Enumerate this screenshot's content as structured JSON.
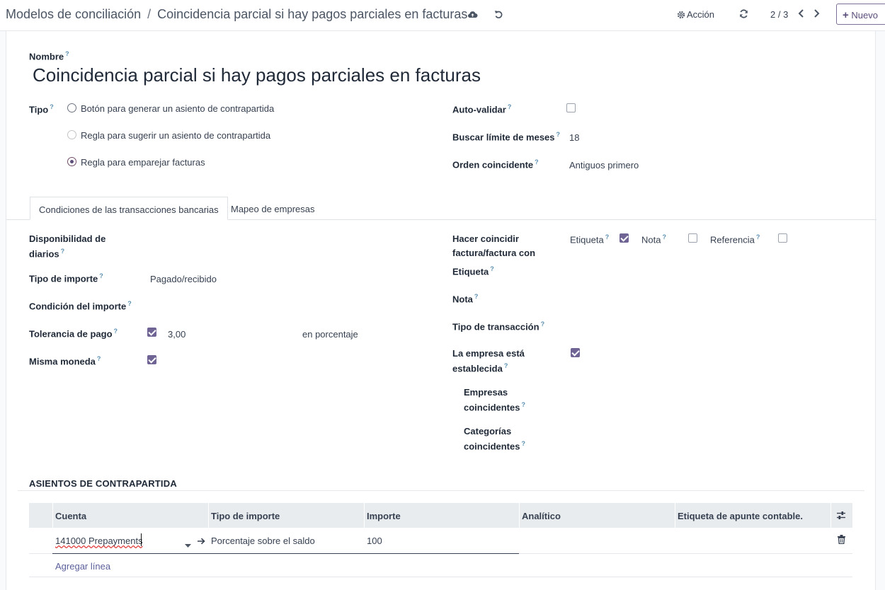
{
  "breadcrumb": {
    "parent": "Modelos de conciliación",
    "separator": "/",
    "current": "Coincidencia parcial si hay pagos parciales en facturas"
  },
  "toolbar": {
    "action_label": "Acción",
    "pager": "2 / 3",
    "new_label": "Nuevo"
  },
  "form": {
    "name_label": "Nombre",
    "name_value": "Coincidencia parcial si hay pagos parciales en facturas",
    "type_label": "Tipo",
    "type_options": [
      "Botón para generar un asiento de contrapartida",
      "Regla para sugerir un asiento de contrapartida",
      "Regla para emparejar facturas"
    ],
    "type_selected": "Regla para emparejar facturas",
    "auto_validate_label": "Auto-validar",
    "auto_validate": false,
    "month_limit_label": "Buscar límite de meses",
    "month_limit_value": "18",
    "match_order_label": "Orden coincidente",
    "match_order_value": "Antiguos primero"
  },
  "tabs": [
    {
      "label": "Condiciones de las transacciones bancarias",
      "active": true
    },
    {
      "label": "Mapeo de empresas",
      "active": false
    }
  ],
  "conditions": {
    "journals_label_1": "Disponibilidad de",
    "journals_label_2": "diarios",
    "amount_type_label": "Tipo de importe",
    "amount_type_value": "Pagado/recibido",
    "amount_condition_label": "Condición del importe",
    "payment_tolerance_label": "Tolerancia de pago",
    "payment_tolerance_checked": true,
    "payment_tolerance_value": "3,00",
    "payment_tolerance_unit": "en porcentaje",
    "same_currency_label": "Misma moneda",
    "same_currency_checked": true,
    "match_invoice_label_1": "Hacer coincidir",
    "match_invoice_label_2": "factura/factura con",
    "match_label_opt": "Etiqueta",
    "match_label_checked": true,
    "match_note_opt": "Nota",
    "match_note_checked": false,
    "match_ref_opt": "Referencia",
    "match_ref_checked": false,
    "label_field": "Etiqueta",
    "note_field": "Nota",
    "transaction_type_label": "Tipo de transacción",
    "partner_set_label_1": "La empresa está",
    "partner_set_label_2": "establecida",
    "partner_set_checked": true,
    "matching_partners_1": "Empresas",
    "matching_partners_2": "coincidentes",
    "matching_categories_1": "Categorías",
    "matching_categories_2": "coincidentes"
  },
  "counterpart": {
    "title": "ASIENTOS DE CONTRAPARTIDA",
    "columns": [
      "Cuenta",
      "Tipo de importe",
      "Importe",
      "Analítico",
      "Etiqueta de apunte contable."
    ],
    "rows": [
      {
        "account": "141000 Prepayments",
        "amount_type": "Porcentaje sobre el saldo",
        "amount": "100",
        "analytic": "",
        "label": ""
      }
    ],
    "add_line": "Agregar línea"
  },
  "colors": {
    "primary": "#714b67",
    "checkbox": "#6f6494",
    "help": "#5b8fb0"
  }
}
